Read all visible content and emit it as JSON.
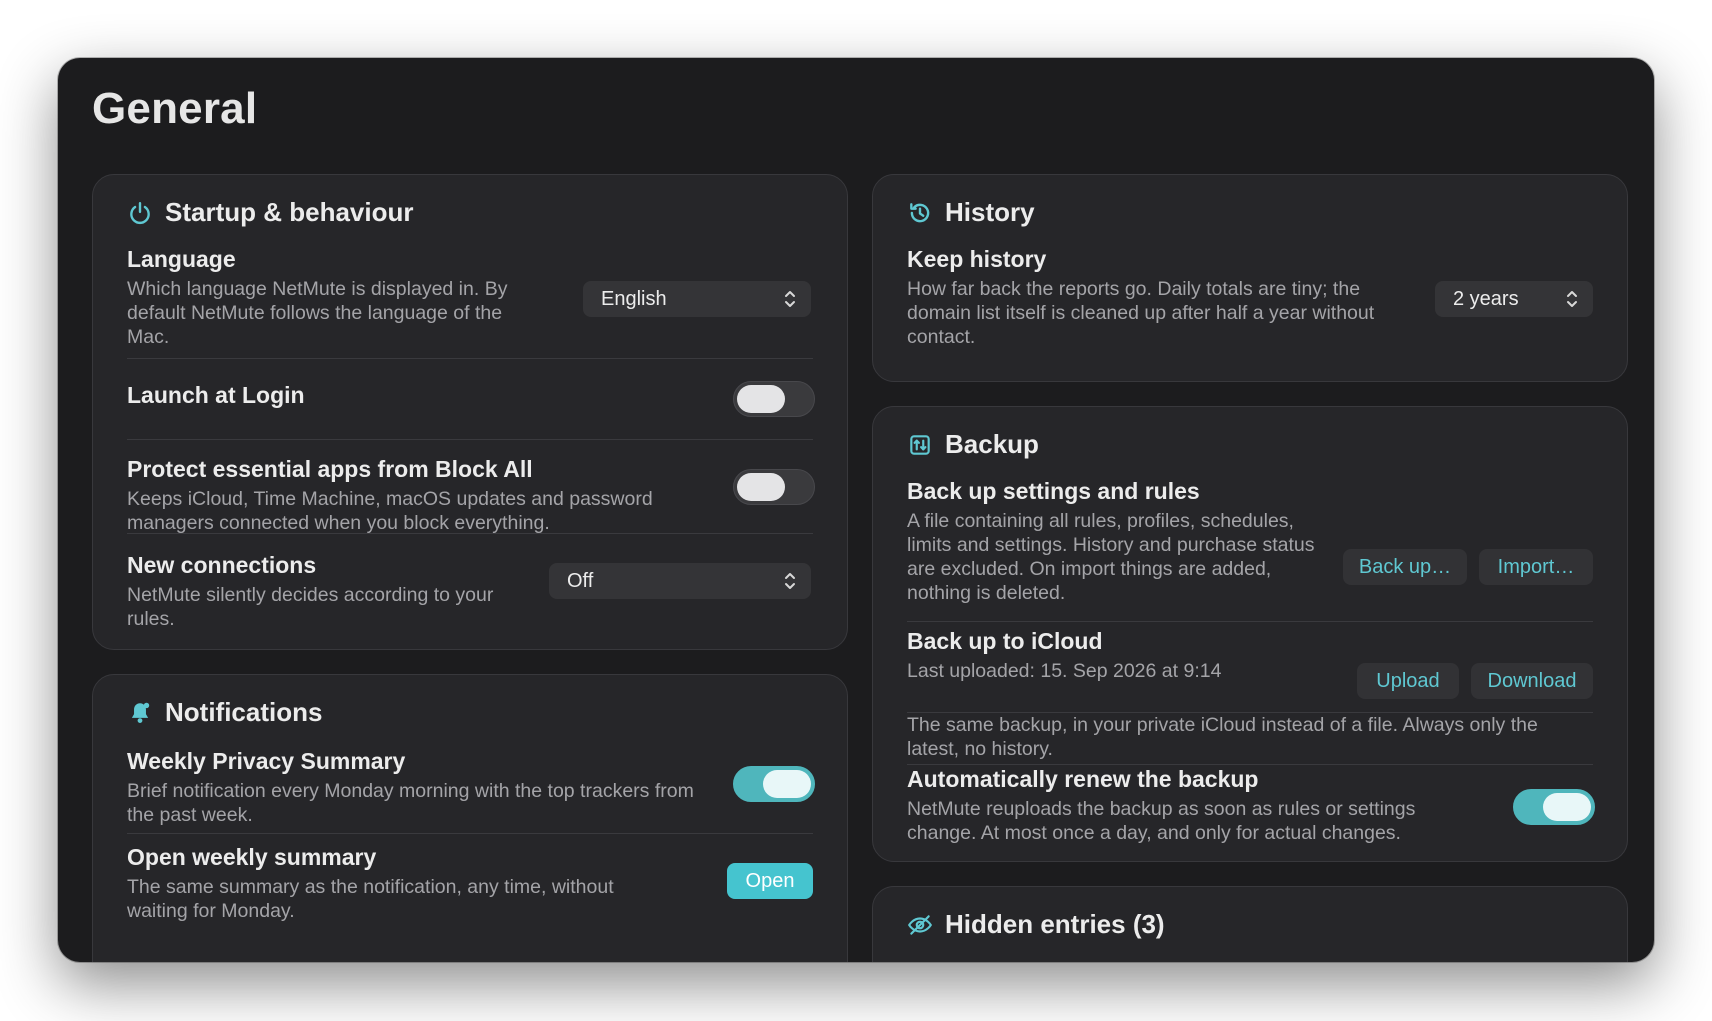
{
  "page": {
    "title": "General"
  },
  "startup": {
    "title": "Startup & behaviour",
    "icon": "power-icon",
    "language": {
      "label": "Language",
      "description": "Which language NetMute is displayed in. By default NetMute follows the language of the Mac.",
      "value": "English"
    },
    "launch_at_login": {
      "label": "Launch at Login",
      "enabled": false
    },
    "protect_essential": {
      "label": "Protect essential apps from Block All",
      "description": "Keeps iCloud, Time Machine, macOS updates and password managers connected when you block everything.",
      "enabled": false
    },
    "new_connections": {
      "label": "New connections",
      "description": "NetMute silently decides according to your rules.",
      "value": "Off"
    }
  },
  "notifications": {
    "title": "Notifications",
    "icon": "bell-icon",
    "weekly_summary": {
      "label": "Weekly Privacy Summary",
      "description": "Brief notification every Monday morning with the top trackers from the past week.",
      "enabled": true
    },
    "open_weekly": {
      "label": "Open weekly summary",
      "description": "The same summary as the notification, any time, without waiting for Monday.",
      "button": "Open"
    }
  },
  "history": {
    "title": "History",
    "icon": "history-icon",
    "keep_history": {
      "label": "Keep history",
      "description": "How far back the reports go. Daily totals are tiny; the domain list itself is cleaned up after half a year without contact.",
      "value": "2 years"
    }
  },
  "backup": {
    "title": "Backup",
    "icon": "backup-icon",
    "settings_rules": {
      "label": "Back up settings and rules",
      "description": "A file containing all rules, profiles, schedules, limits and settings. History and purchase status are excluded. On import things are added, nothing is deleted.",
      "backup_button": "Back up…",
      "import_button": "Import…"
    },
    "icloud": {
      "label": "Back up to iCloud",
      "last_uploaded": "Last uploaded: 15. Sep 2026 at 9:14",
      "upload_button": "Upload",
      "download_button": "Download",
      "description": "The same backup, in your private iCloud instead of a file. Always only the latest, no history."
    },
    "auto_renew": {
      "label": "Automatically renew the backup",
      "description": "NetMute reuploads the backup as soon as rules or settings change. At most once a day, and only for actual changes.",
      "enabled": true
    }
  },
  "hidden": {
    "title": "Hidden entries (3)",
    "icon": "eye-slash-icon"
  },
  "colors": {
    "window_bg": "#1c1c1e",
    "card_bg": "#262629",
    "accent": "#4fb6bc",
    "link": "#5fc8d2"
  }
}
